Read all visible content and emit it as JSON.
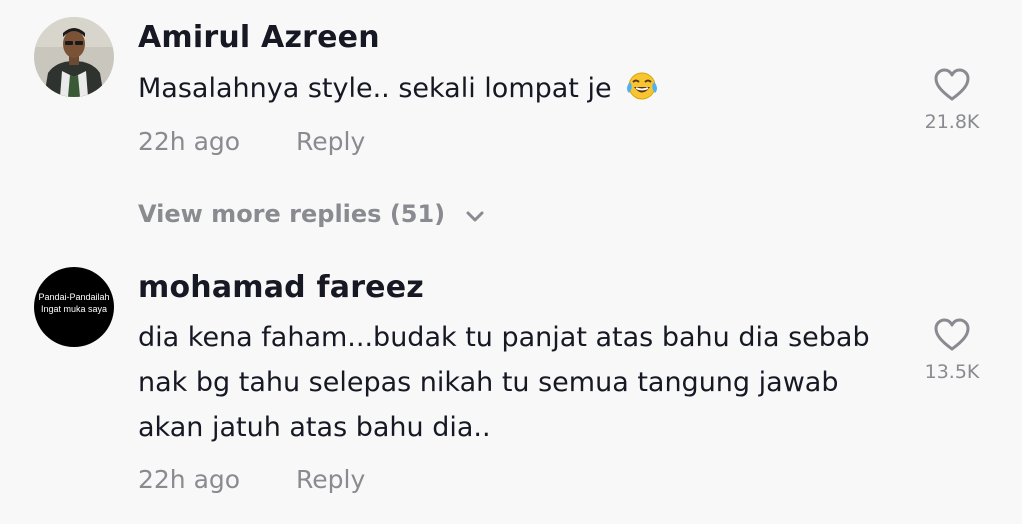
{
  "comments": [
    {
      "username": "Amirul Azreen",
      "text": "Masalahnya style.. sekali lompat je",
      "emoji": "face-with-tears-of-joy",
      "time": "22h ago",
      "reply_label": "Reply",
      "like_count": "21.8K",
      "view_more": "View more replies (51)"
    },
    {
      "username": "mohamad fareez",
      "text": "dia kena faham...budak tu panjat atas bahu dia sebab nak bg tahu selepas nikah tu semua tangung jawab akan jatuh atas bahu dia..",
      "avatar_text_line1": "Pandai-Pandailah",
      "avatar_text_line2": "Ingat muka saya",
      "time": "22h ago",
      "reply_label": "Reply",
      "like_count": "13.5K"
    }
  ],
  "colors": {
    "background": "#f8f8f8",
    "text_primary": "#161823",
    "text_secondary": "#8a8b91"
  }
}
